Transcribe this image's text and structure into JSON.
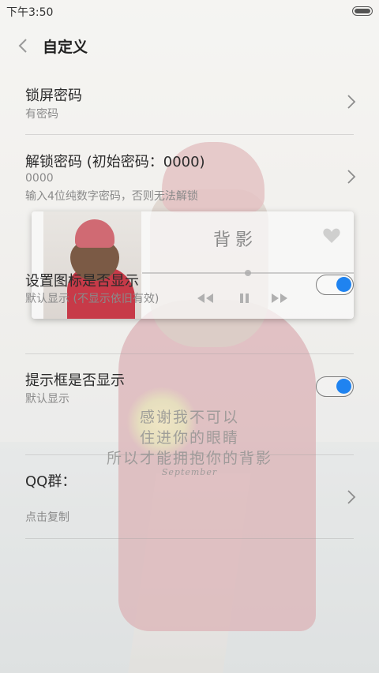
{
  "status_bar": {
    "time": "下午3:50"
  },
  "header": {
    "title": "自定义"
  },
  "rows": [
    {
      "title": "锁屏密码",
      "subtitle": "有密码"
    },
    {
      "title": "解锁密码 (初始密码：0000)",
      "value": "0000",
      "hint": "输入4位纯数字密码，否则无法解锁"
    },
    {
      "title": "设置图标是否显示",
      "subtitle": "默认显示 (不显示依旧有效)",
      "enabled": true
    },
    {
      "title": "提示框是否显示",
      "subtitle": "默认显示",
      "enabled": true
    },
    {
      "title": "QQ群：",
      "subtitle": "点击复制"
    }
  ],
  "music_widget": {
    "song_title": "背影",
    "progress": 0.5
  },
  "wallpaper_text": {
    "lines": [
      "感谢我不可以",
      "住进你的眼睛",
      "所以才能拥抱你的背影"
    ],
    "signature": "September"
  },
  "colors": {
    "accent": "#1f83f0"
  },
  "icons": [
    "back-arrow-icon",
    "chevron-right-icon",
    "heart-icon",
    "previous-icon",
    "pause-icon",
    "next-icon",
    "battery-icon"
  ]
}
